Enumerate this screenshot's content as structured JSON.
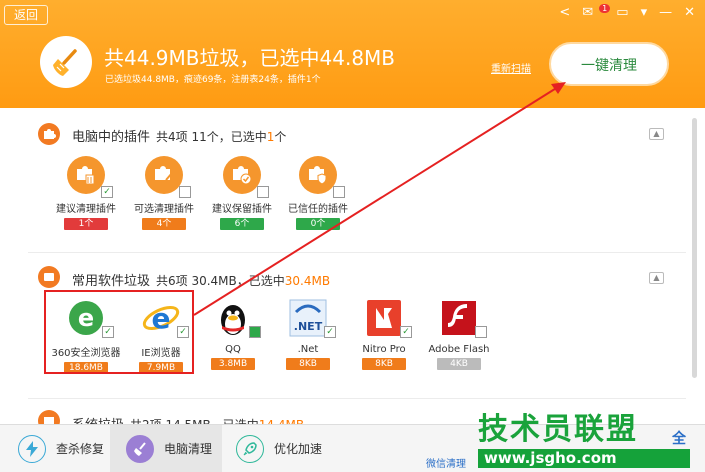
{
  "header": {
    "back": "返回",
    "headline": "共44.9MB垃圾，已选中44.8MB",
    "subline": "已选垃圾44.8MB，痕迹69条，注册表24条，插件1个",
    "rescan": "重新扫描",
    "clean_button": "一键清理",
    "mail_count": "1"
  },
  "plugins": {
    "title": "电脑中的插件",
    "summary_pre": "共4项 11个，已选中",
    "summary_hl": "1",
    "summary_post": "个",
    "items": [
      {
        "label": "建议清理插件",
        "count": "1个",
        "color": "#e23b3b",
        "checked": "✓"
      },
      {
        "label": "可选清理插件",
        "count": "4个",
        "color": "#f07c1b",
        "checked": ""
      },
      {
        "label": "建议保留插件",
        "count": "6个",
        "color": "#2ea84a",
        "checked": ""
      },
      {
        "label": "已信任的插件",
        "count": "0个",
        "color": "#2ea84a",
        "checked": ""
      }
    ]
  },
  "software": {
    "title": "常用软件垃圾",
    "summary_pre": "共6项 30.4MB，已选中",
    "summary_hl": "30.4MB",
    "items": [
      {
        "label": "360安全浏览器",
        "size": "18.6MB",
        "color": "#f07c1b"
      },
      {
        "label": "IE浏览器",
        "size": "7.9MB",
        "color": "#f07c1b"
      },
      {
        "label": "QQ",
        "size": "3.8MB",
        "color": "#f07c1b"
      },
      {
        "label": ".Net",
        "size": "8KB",
        "color": "#f07c1b"
      },
      {
        "label": "Nitro Pro",
        "size": "8KB",
        "color": "#f07c1b"
      },
      {
        "label": "Adobe Flash",
        "size": "4KB",
        "color": "#bbbbbb"
      }
    ]
  },
  "system": {
    "title": "系统垃圾",
    "summary_pre": "共2项 14.5MB，已选中",
    "summary_hl": "14.4MB"
  },
  "footer": {
    "tabs": [
      "查杀修复",
      "电脑清理",
      "优化加速"
    ],
    "wechat": "微信清理"
  },
  "watermark": {
    "big": "技术员联盟",
    "url": "www.jsgho.com",
    "side": "全"
  }
}
